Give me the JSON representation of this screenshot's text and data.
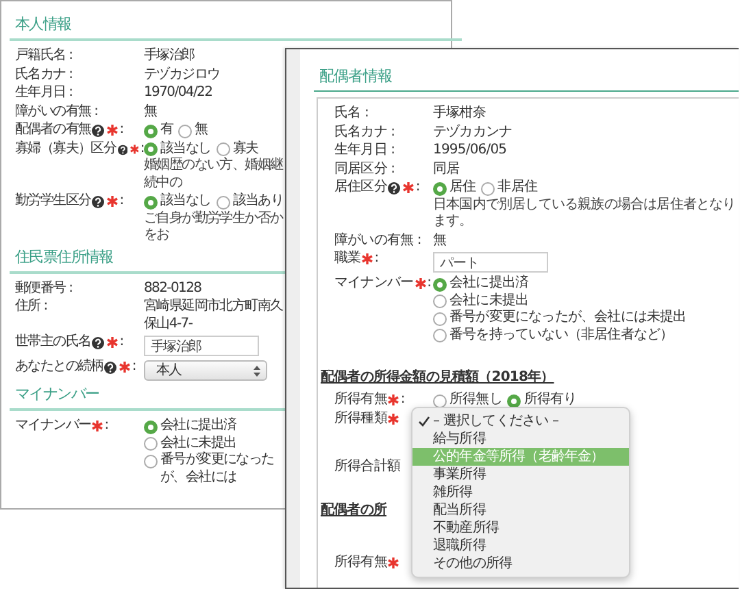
{
  "back_window": {
    "sections": [
      {
        "title": "本人情報",
        "rows": [
          {
            "kind": "text",
            "label": "戸籍氏名 :",
            "value": "手塚治郎"
          },
          {
            "kind": "text",
            "label": "氏名カナ :",
            "value": "テヅカジロウ"
          },
          {
            "kind": "text",
            "label": "生年月日 :",
            "value": "1970/04/22"
          },
          {
            "kind": "text",
            "label": "障がいの有無 :",
            "value": "無"
          },
          {
            "kind": "radio",
            "label": "配偶者の有無",
            "help": true,
            "required": true,
            "colon": ":",
            "options": [
              {
                "label": "有",
                "selected": true
              },
              {
                "label": "無",
                "selected": false
              }
            ]
          },
          {
            "kind": "radio",
            "label": "寡婦（寡夫）区分",
            "help": true,
            "required": true,
            "colon": ":",
            "options": [
              {
                "label": "該当なし",
                "selected": true
              },
              {
                "label": "寡夫",
                "selected": false
              }
            ],
            "note": "婚姻歴のない方、婚姻継続中の"
          },
          {
            "kind": "radio",
            "label": "勤労学生区分",
            "help": true,
            "required": true,
            "colon": ":",
            "options": [
              {
                "label": "該当なし",
                "selected": true
              },
              {
                "label": "該当あり",
                "selected": false
              }
            ],
            "note": "ご自身が勤労学生か否かをお"
          }
        ]
      },
      {
        "title": "住民票住所情報",
        "rows": [
          {
            "kind": "text",
            "label": "郵便番号 :",
            "value": "882-0128"
          },
          {
            "kind": "text",
            "label": "住所 :",
            "value": "宮崎県延岡市北方町南久保山4-7-"
          },
          {
            "kind": "input",
            "label": "世帯主の氏名",
            "help": true,
            "required": true,
            "colon": ":",
            "value": "手塚治郎"
          },
          {
            "kind": "select",
            "label": "あなたとの続柄",
            "help": true,
            "required": true,
            "colon": ":",
            "value": "本人"
          }
        ]
      },
      {
        "title": "マイナンバー",
        "rows": [
          {
            "kind": "radio-list",
            "label": "マイナンバー",
            "required": true,
            "colon": ":",
            "options": [
              {
                "label": "会社に提出済",
                "selected": true
              },
              {
                "label": "会社に未提出",
                "selected": false
              },
              {
                "label": "番号が変更になったが、会社には",
                "selected": false
              }
            ]
          }
        ]
      }
    ]
  },
  "front_window": {
    "title": "配偶者情報",
    "groups": [
      {
        "rows": [
          {
            "kind": "text",
            "label": "氏名 :",
            "value": "手塚柑奈"
          },
          {
            "kind": "text",
            "label": "氏名カナ :",
            "value": "テヅカカンナ"
          },
          {
            "kind": "text",
            "label": "生年月日 :",
            "value": "1995/06/05"
          },
          {
            "kind": "text",
            "label": "同居区分 :",
            "value": "同居"
          },
          {
            "kind": "radio",
            "label": "居住区分",
            "help": true,
            "required": true,
            "colon": ":",
            "options": [
              {
                "label": "居住",
                "selected": true
              },
              {
                "label": "非居住",
                "selected": false
              }
            ],
            "note": "日本国内で別居している親族の場合は居住者となります。"
          },
          {
            "kind": "text",
            "label": "障がいの有無 :",
            "value": "無"
          },
          {
            "kind": "input",
            "label": "職業",
            "required": true,
            "colon": ":",
            "value": "パート"
          },
          {
            "kind": "radio-list",
            "label": "マイナンバー",
            "required": true,
            "colon": ":",
            "options": [
              {
                "label": "会社に提出済",
                "selected": true
              },
              {
                "label": "会社に未提出",
                "selected": false
              },
              {
                "label": "番号が変更になったが、会社には未提出",
                "selected": false
              },
              {
                "label": "番号を持っていない（非居住者など）",
                "selected": false
              }
            ]
          }
        ]
      },
      {
        "title": "配偶者の所得金額の見積額（2018年）",
        "rows": [
          {
            "kind": "radio",
            "label": "所得有無",
            "required": true,
            "colon": ":",
            "options": [
              {
                "label": "所得無し",
                "selected": false
              },
              {
                "label": "所得有り",
                "selected": true
              }
            ]
          },
          {
            "kind": "menu",
            "label": "所得種類",
            "required": true,
            "menu": [
              {
                "label": "– 選択してください –",
                "checked": true,
                "selected": false
              },
              {
                "label": "給与所得",
                "checked": false,
                "selected": false
              },
              {
                "label": "公的年金等所得（老齢年金）",
                "checked": false,
                "selected": true
              },
              {
                "label": "事業所得",
                "checked": false,
                "selected": false
              },
              {
                "label": "雑所得",
                "checked": false,
                "selected": false
              },
              {
                "label": "配当所得",
                "checked": false,
                "selected": false
              },
              {
                "label": "不動産所得",
                "checked": false,
                "selected": false
              },
              {
                "label": "退職所得",
                "checked": false,
                "selected": false
              },
              {
                "label": "その他の所得",
                "checked": false,
                "selected": false
              }
            ]
          },
          {
            "kind": "label",
            "label": "所得合計額"
          }
        ]
      },
      {
        "title": "配偶者の所",
        "rows": [
          {
            "kind": "label",
            "label": "所得有無",
            "required": true
          }
        ]
      }
    ]
  }
}
